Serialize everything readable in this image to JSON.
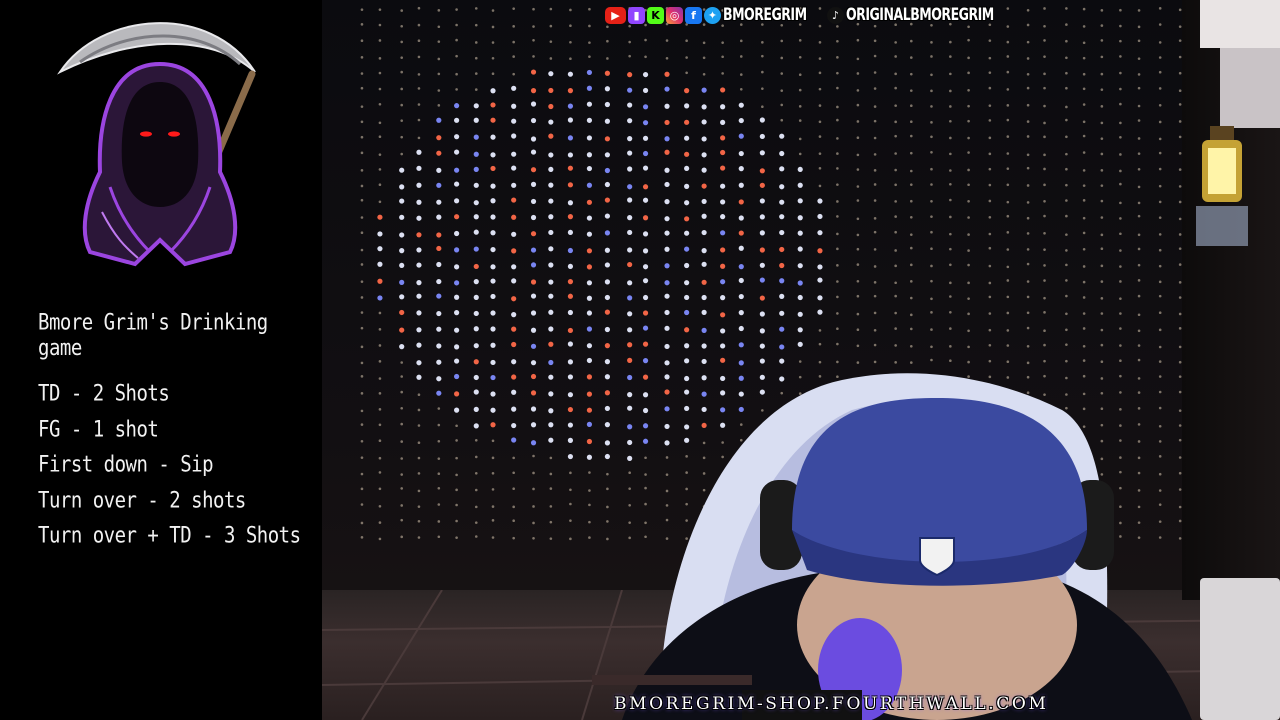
{
  "overlay": {
    "rules_title": "Bmore Grim's Drinking game",
    "rules": [
      "TD - 2 Shots",
      "FG - 1 shot",
      "First down - Sip",
      "Turn over - 2 shots",
      "Turn over + TD - 3 Shots"
    ]
  },
  "social_bar": {
    "icons": [
      "youtube-icon",
      "twitch-icon",
      "kick-icon",
      "instagram-icon",
      "facebook-icon",
      "twitter-icon",
      "tiktok-icon"
    ],
    "handle_primary": "BMOREGRIM",
    "handle_tiktok": "ORIGINALBMOREGRIM"
  },
  "footer": {
    "shop_url": "BMOREGRIM-SHOP.FOURTHWALL.COM"
  },
  "colors": {
    "overlay_bg": "#000000",
    "hood_purple": "#8a3bd1",
    "eye_red": "#ff1a1a"
  }
}
